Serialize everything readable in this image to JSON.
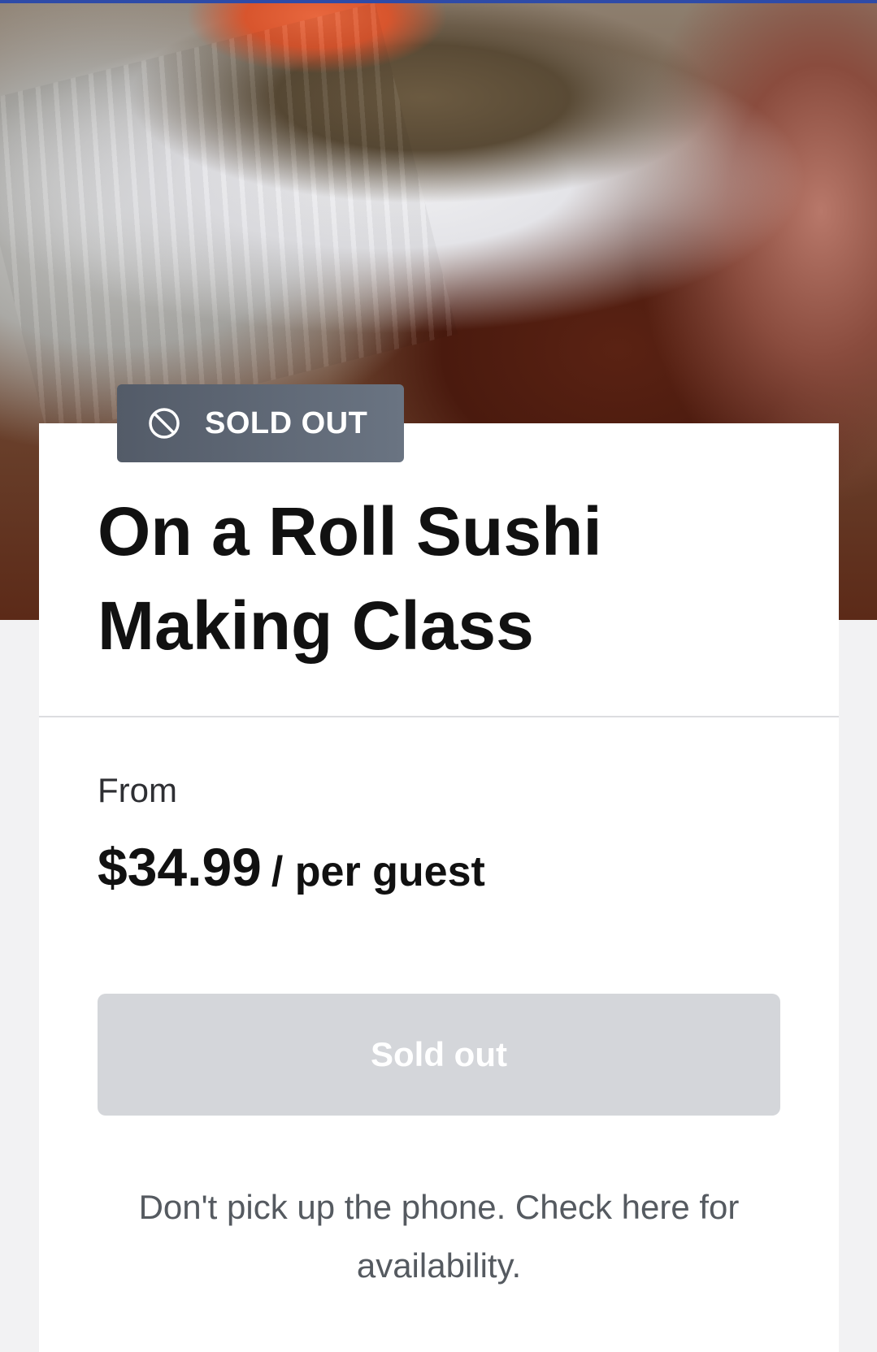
{
  "badge": {
    "icon": "prohibited-icon",
    "label": "SOLD OUT"
  },
  "class": {
    "title": "On a Roll Sushi Making Class"
  },
  "pricing": {
    "from_label": "From",
    "amount": "$34.99",
    "unit": "/ per guest"
  },
  "cta": {
    "label": "Sold out",
    "disabled": true
  },
  "availability_note": "Don't pick up the phone. Check here for availability.",
  "colors": {
    "accent_bar": "#2e4ba8",
    "badge_bg": "#5f6876",
    "button_disabled_bg": "#d4d6da",
    "title_text": "#111111",
    "note_text": "#555a60"
  }
}
